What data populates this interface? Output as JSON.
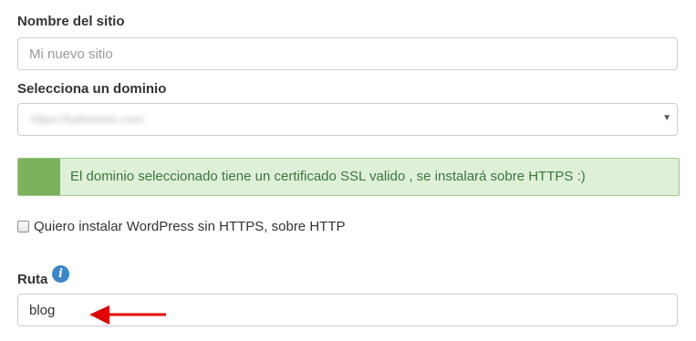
{
  "site_name": {
    "label": "Nombre del sitio",
    "placeholder": "Mi nuevo sitio",
    "value": ""
  },
  "domain": {
    "label": "Selecciona un dominio",
    "selected_value": "https://tudominio.com"
  },
  "ssl_alert": {
    "message": "El dominio seleccionado tiene un certificado SSL valido , se instalará sobre HTTPS :)",
    "accent_color": "#7bb35c",
    "background_color": "#dff0d8",
    "text_color": "#3c763d"
  },
  "http_option": {
    "label": "Quiero instalar WordPress sin HTTPS, sobre HTTP",
    "checked": false
  },
  "path": {
    "label": "Ruta",
    "value": "blog",
    "info_icon": "info-icon"
  },
  "annotation": {
    "icon": "red-arrow-left",
    "color": "#e00000"
  }
}
